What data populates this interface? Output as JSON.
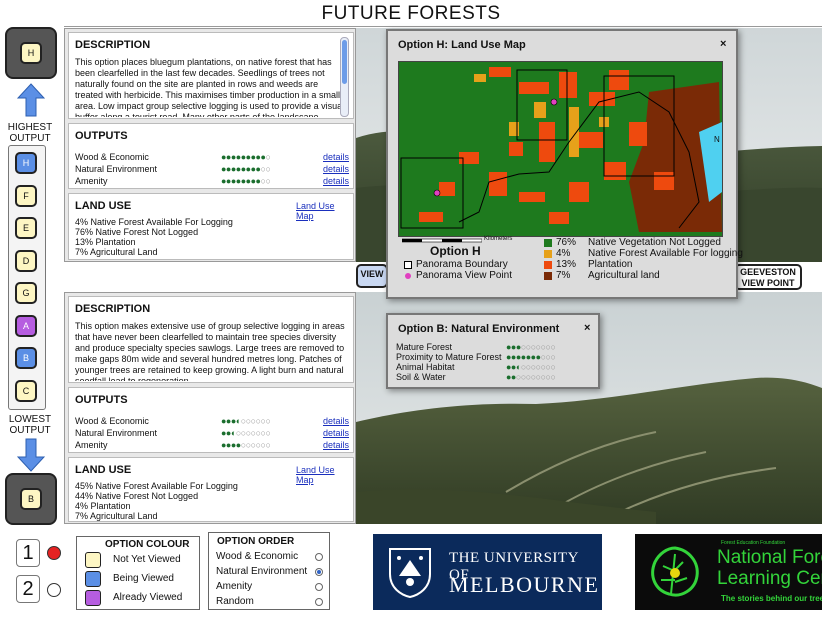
{
  "app_title": "FUTURE FORESTS",
  "nav": {
    "top_selected": "H",
    "bottom_selected": "B",
    "highest_label": "HIGHEST OUTPUT",
    "lowest_label": "LOWEST OUTPUT",
    "options": [
      {
        "letter": "H",
        "state": "Being Viewed"
      },
      {
        "letter": "F",
        "state": "Not Yet Viewed"
      },
      {
        "letter": "E",
        "state": "Not Yet Viewed"
      },
      {
        "letter": "D",
        "state": "Not Yet Viewed"
      },
      {
        "letter": "G",
        "state": "Not Yet Viewed"
      },
      {
        "letter": "A",
        "state": "Already Viewed"
      },
      {
        "letter": "B",
        "state": "Being Viewed"
      },
      {
        "letter": "C",
        "state": "Not Yet Viewed"
      }
    ]
  },
  "panel_top": {
    "description_heading": "DESCRIPTION",
    "description": "This option places bluegum plantations, on native forest that has been clearfelled in the last few decades. Seedlings of trees not naturally found on the site are planted in rows and weeds are treated with herbicide. This maximises timber production in a small area. Low impact group selective logging is used to provide a visual buffer along a tourist road. Many other parts of the landscape remain unaffected by logging.",
    "outputs_heading": "OUTPUTS",
    "outputs": [
      {
        "label": "Wood & Economic",
        "score": 9,
        "link": "details"
      },
      {
        "label": "Natural Environment",
        "score": 8,
        "link": "details"
      },
      {
        "label": "Amenity",
        "score": 8,
        "link": "details"
      }
    ],
    "landuse_heading": "LAND USE",
    "landuse_link": "Land Use Map",
    "landuse": [
      "4% Native Forest Available For Logging",
      "76% Native Forest Not Logged",
      "13% Plantation",
      "7% Agricultural Land"
    ]
  },
  "panel_bottom": {
    "description_heading": "DESCRIPTION",
    "description": "This option makes extensive use of group selective logging in areas that have never been clearfelled to maintain tree species diversity and produce specialty species sawlogs. Large trees are removed to make gaps 80m wide and several hundred metres long. Patches of younger trees are retained to keep growing. A light burn and natural seedfall lead to regeneration.",
    "outputs_heading": "OUTPUTS",
    "outputs": [
      {
        "label": "Wood & Economic",
        "score": 3.5,
        "link": "details"
      },
      {
        "label": "Natural Environment",
        "score": 2.5,
        "link": "details"
      },
      {
        "label": "Amenity",
        "score": 4,
        "link": "details"
      }
    ],
    "landuse_heading": "LAND USE",
    "landuse_link": "Land Use Map",
    "landuse": [
      "45% Native Forest Available For Logging",
      "44% Native Forest Not Logged",
      "4% Plantation",
      "7% Agricultural Land"
    ]
  },
  "view_buttons": {
    "left_partial": "VIEW",
    "right_line1": "GEEVESTON",
    "right_line2": "VIEW POINT"
  },
  "land_use_popup": {
    "title": "Option H: Land Use Map",
    "close": "×",
    "map_option_label": "Option H",
    "scale_label": "Kilometers",
    "north": "N",
    "legend_left": [
      {
        "label": "Panorama Boundary"
      },
      {
        "label": "Panorama View Point"
      }
    ],
    "legend_right": [
      {
        "pct": "76%",
        "label": "Native Vegetation Not Logged",
        "color": "#1e7a1e"
      },
      {
        "pct": "4%",
        "label": "Native Forest Available For logging",
        "color": "#e6a11a"
      },
      {
        "pct": "13%",
        "label": "Plantation",
        "color": "#ee4a0e"
      },
      {
        "pct": "7%",
        "label": "Agricultural land",
        "color": "#7a2a06"
      }
    ]
  },
  "env_popup": {
    "title": "Option B: Natural Environment",
    "close": "×",
    "rows": [
      {
        "label": "Mature Forest",
        "score": 3
      },
      {
        "label": "Proximity to Mature Forest",
        "score": 7
      },
      {
        "label": "Animal Habitat",
        "score": 2.5
      },
      {
        "label": "Soil & Water",
        "score": 2
      }
    ]
  },
  "bottom": {
    "num1": "1",
    "num2": "2",
    "colour_heading": "OPTION COLOUR",
    "colour_keys": [
      {
        "label": "Not Yet Viewed",
        "color": "#fdf6c3"
      },
      {
        "label": "Being Viewed",
        "color": "#5b8fe5"
      },
      {
        "label": "Already Viewed",
        "color": "#b65de0"
      }
    ],
    "order_heading": "OPTION ORDER",
    "order_options": [
      {
        "label": "Wood & Economic",
        "selected": false
      },
      {
        "label": "Natural Environment",
        "selected": true
      },
      {
        "label": "Amenity",
        "selected": false
      },
      {
        "label": "Random",
        "selected": false
      }
    ]
  },
  "logos": {
    "uom_line1": "THE UNIVERSITY OF",
    "uom_line2": "MELBOURNE",
    "nflc_top": "Forest Education Foundation",
    "nflc_line1": "National Fore",
    "nflc_line2": "Learning Cen",
    "nflc_tag": "The stories behind our trees"
  },
  "colors": {
    "not_viewed": "#fdf6c3",
    "being_viewed": "#5b8fe5",
    "already_viewed": "#b65de0",
    "score_dot": "#1b6e2e",
    "uom_navy": "#0b2a5b",
    "nflc_green": "#33d43a"
  }
}
